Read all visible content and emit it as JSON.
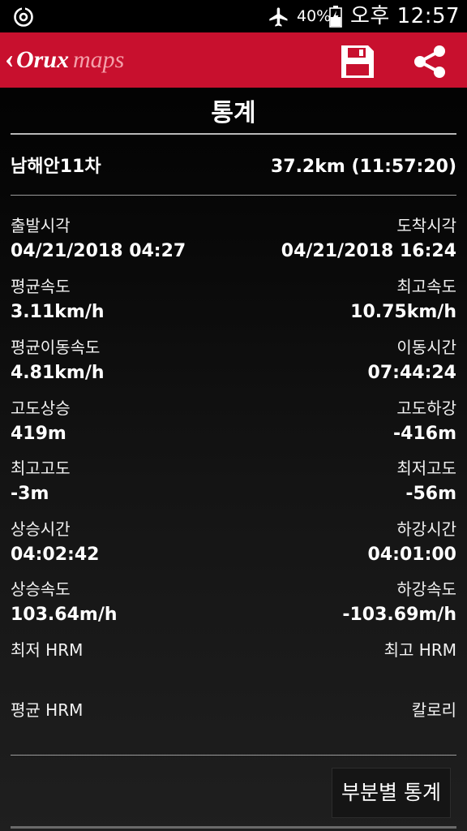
{
  "status_bar": {
    "battery_pct": "40%",
    "time": "오후 12:57",
    "icons": [
      "app-sync-icon",
      "airplane-mode-icon",
      "battery-charging-icon"
    ]
  },
  "app_bar": {
    "logo_main": "Orux",
    "logo_sub": "maps",
    "logo_back_glyph": "‹",
    "bg_color": "#c8102e",
    "icons": [
      "floppy-save-icon",
      "share-icon"
    ]
  },
  "page": {
    "title": "통계"
  },
  "track": {
    "name": "남해안11차",
    "summary": "37.2km (11:57:20)"
  },
  "stats": [
    {
      "left_label": "출발시각",
      "left_value": "04/21/2018 04:27",
      "right_label": "도착시각",
      "right_value": "04/21/2018 16:24"
    },
    {
      "left_label": "평균속도",
      "left_value": "3.11km/h",
      "right_label": "최고속도",
      "right_value": "10.75km/h"
    },
    {
      "left_label": "평균이동속도",
      "left_value": "4.81km/h",
      "right_label": "이동시간",
      "right_value": "07:44:24"
    },
    {
      "left_label": "고도상승",
      "left_value": "419m",
      "right_label": "고도하강",
      "right_value": "-416m"
    },
    {
      "left_label": "최고고도",
      "left_value": "-3m",
      "right_label": "최저고도",
      "right_value": "-56m"
    },
    {
      "left_label": "상승시간",
      "left_value": "04:02:42",
      "right_label": "하강시간",
      "right_value": "04:01:00"
    },
    {
      "left_label": "상승속도",
      "left_value": "103.64m/h",
      "right_label": "하강속도",
      "right_value": "-103.69m/h"
    },
    {
      "left_label": "최저 HRM",
      "left_value": "",
      "right_label": "최고 HRM",
      "right_value": ""
    },
    {
      "left_label": "평균 HRM",
      "left_value": "",
      "right_label": "칼로리",
      "right_value": ""
    }
  ],
  "footer": {
    "partial_stats_label": "부분별 통계"
  }
}
